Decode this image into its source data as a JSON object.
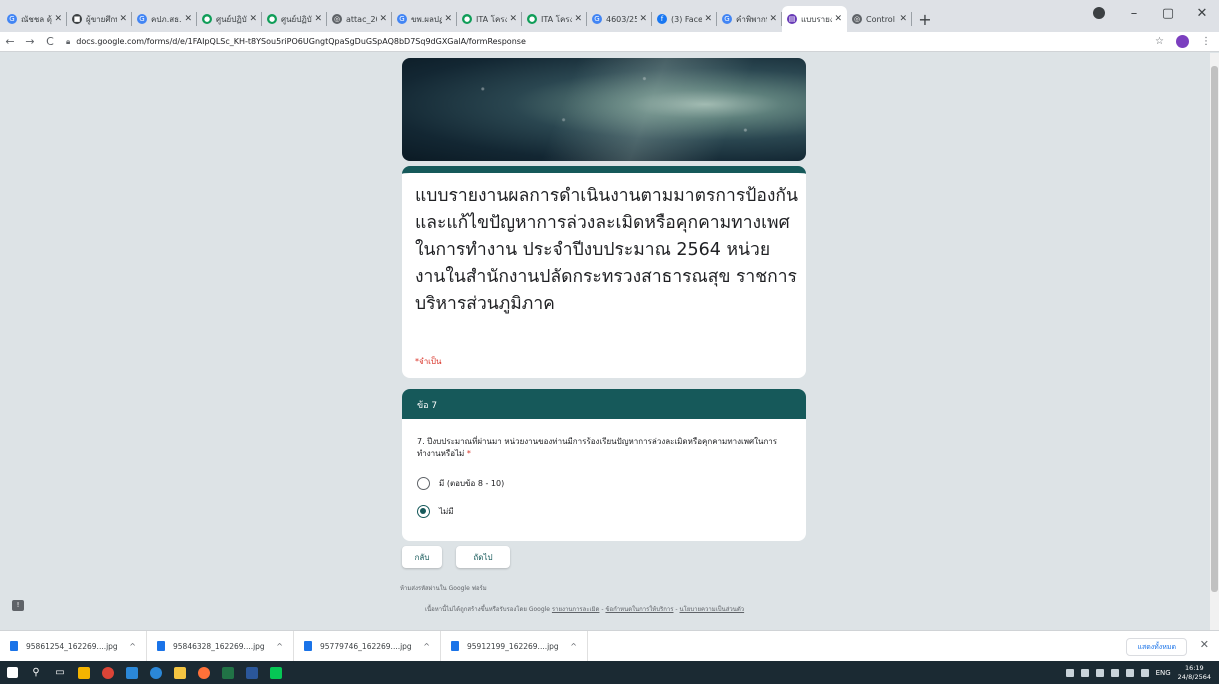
{
  "browser": {
    "tabs": [
      {
        "label": "ณัชชล ดุ้ม",
        "color": "#4285f4",
        "glyph": "G"
      },
      {
        "label": "ผู้ขายศึกษา",
        "color": "#3c4043",
        "glyph": "■"
      },
      {
        "label": "คปภ.สธ.",
        "color": "#4285f4",
        "glyph": "G"
      },
      {
        "label": "ศูนย์ปฏิบัติ",
        "color": "#0f9d58",
        "glyph": "●"
      },
      {
        "label": "ศูนย์ปฏิบัติ",
        "color": "#0f9d58",
        "glyph": "●"
      },
      {
        "label": "attac_202",
        "color": "#5f6368",
        "glyph": "◎"
      },
      {
        "label": "ขพ.ผลปฏ",
        "color": "#4285f4",
        "glyph": "G"
      },
      {
        "label": "ITA โครงก",
        "color": "#0f9d58",
        "glyph": "●"
      },
      {
        "label": "ITA โครงก",
        "color": "#0f9d58",
        "glyph": "●"
      },
      {
        "label": "4603/256",
        "color": "#4285f4",
        "glyph": "G"
      },
      {
        "label": "(3) Facebo",
        "color": "#1877f2",
        "glyph": "f"
      },
      {
        "label": "คำพิพากษ",
        "color": "#4285f4",
        "glyph": "G"
      },
      {
        "label": "แบบรายงาน",
        "color": "#673ab7",
        "glyph": "▤",
        "active": true
      },
      {
        "label": "Control P",
        "color": "#5f6368",
        "glyph": "◎"
      }
    ],
    "new_tab": "+",
    "minimize": "–",
    "maximize": "▢",
    "close": "✕",
    "back": "←",
    "forward": "→",
    "reload": "C",
    "url": "docs.google.com/forms/d/e/1FAIpQLSc_KH-t8YSou5riPO6UGngtQpaSgDuGSpAQ8bD7Sq9dGXGalA/formResponse",
    "star": "☆",
    "menu": "⋮"
  },
  "form": {
    "title": "แบบรายงานผลการดำเนินงานตามมาตรการป้องกันและแก้ไขปัญหาการล่วงละเมิดหรือคุกคามทางเพศในการทำงาน ประจำปีงบประมาณ 2564 หน่วยงานในสำนักงานปลัดกระทรวงสาธารณสุข ราชการบริหารส่วนภูมิภาค",
    "required_note": "*จำเป็น",
    "section_header": "ข้อ 7",
    "question": "7. ปีงบประมาณที่ผ่านมา หน่วยงานของท่านมีการร้องเรียนปัญหาการล่วงละเมิดหรือคุกคามทางเพศในการทำงานหรือไม่",
    "required_star": "*",
    "options": [
      {
        "label": "มี (ตอบข้อ 8 - 10)",
        "selected": false
      },
      {
        "label": "ไม่มี",
        "selected": true
      }
    ],
    "back_button": "กลับ",
    "next_button": "ถัดไป",
    "footer_line1": "ห้ามส่งรหัสผ่านใน Google ฟอร์ม",
    "footer_line2_prefix": "เนื้อหานี้ไม่ได้ถูกสร้างขึ้นหรือรับรองโดย Google",
    "footer_link_report": "รายงานการละเมิด",
    "footer_link_terms": "ข้อกำหนดในการให้บริการ",
    "footer_link_privacy": "นโยบายความเป็นส่วนตัว"
  },
  "downloads": {
    "items": [
      {
        "name": "95861254_162269....jpg"
      },
      {
        "name": "95846328_162269....jpg"
      },
      {
        "name": "95779746_162269....jpg"
      },
      {
        "name": "95912199_162269....jpg"
      }
    ],
    "show_all": "แสดงทั้งหมด",
    "close": "✕"
  },
  "taskbar": {
    "lang": "ENG",
    "time": "16:19",
    "date": "24/8/2564"
  }
}
